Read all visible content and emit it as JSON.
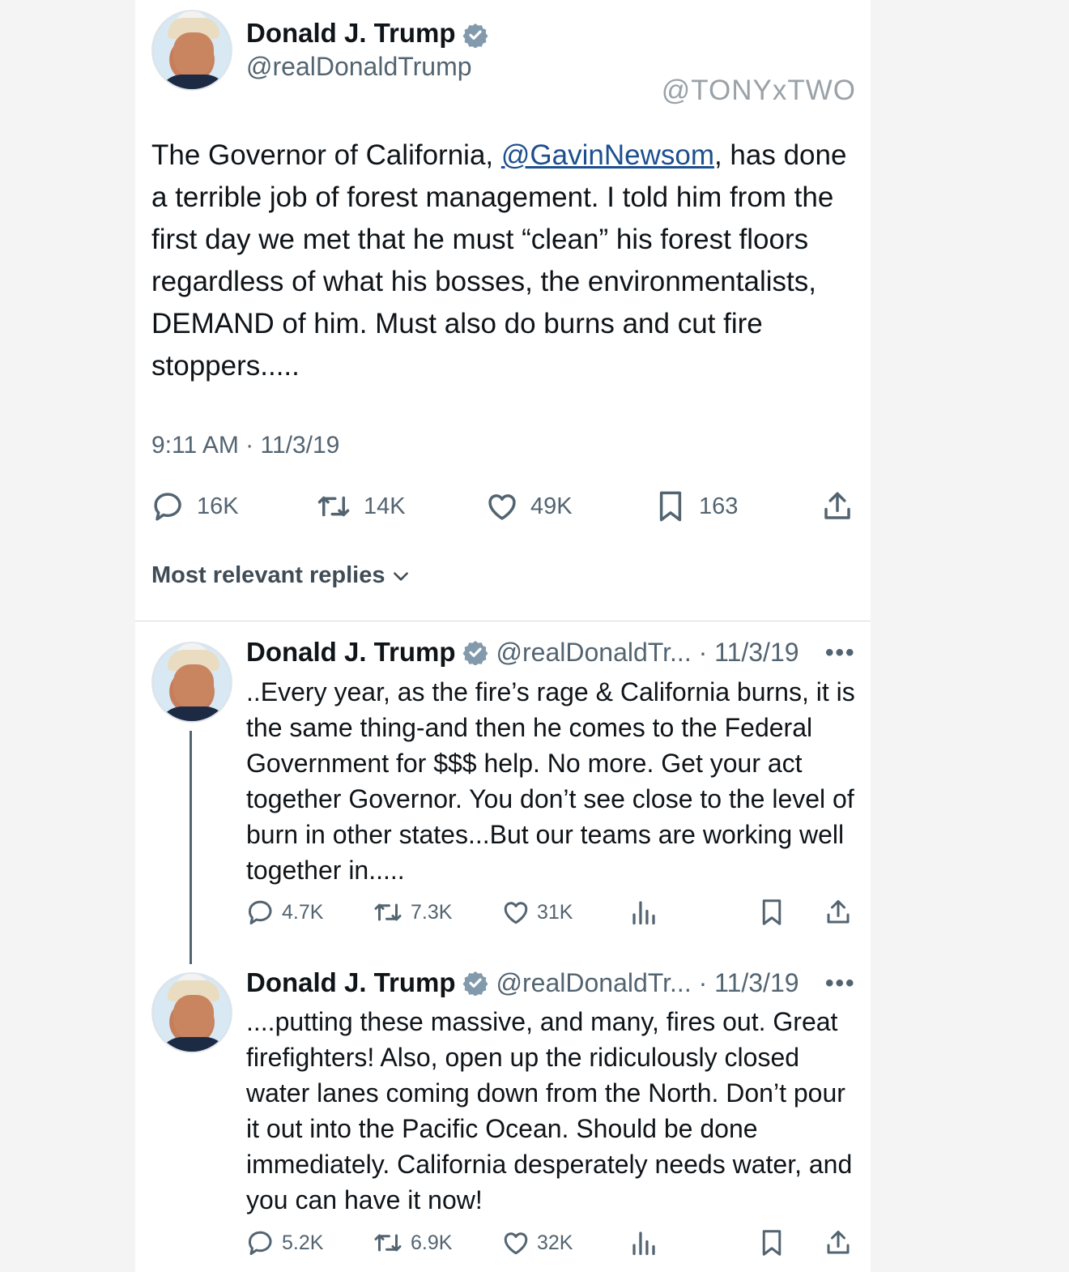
{
  "watermark": "@TONYxTWO",
  "main_tweet": {
    "name": "Donald J. Trump",
    "handle": "@realDonaldTrump",
    "text_before_mention": "The Governor of California, ",
    "mention": "@GavinNewsom",
    "text_after_mention": ", has done a terrible job of forest management. I told him from the first day we met that he must “clean” his forest floors regardless of what his bosses, the environmentalists, DEMAND of him. Must also do burns and cut fire stoppers.....",
    "timestamp": "9:11 AM · 11/3/19",
    "replies": "16K",
    "retweets": "14K",
    "likes": "49K",
    "bookmarks": "163"
  },
  "sort_label": "Most relevant replies",
  "replies": [
    {
      "name": "Donald J. Trump",
      "handle_date": "@realDonaldTr... · 11/3/19",
      "more": "•••",
      "text": "..Every year, as the fire’s rage & California burns, it is the same thing-and then he comes to the Federal Government for $$$ help. No more. Get your act together Governor. You don’t see close to the level of burn in other states...But our teams are working well together in.....",
      "replies": "4.7K",
      "retweets": "7.3K",
      "likes": "31K"
    },
    {
      "name": "Donald J. Trump",
      "handle_date": "@realDonaldTr... · 11/3/19",
      "more": "•••",
      "text": "....putting these massive, and many, fires out. Great firefighters! Also, open up the ridiculously closed water lanes coming down from the North. Don’t pour it out into the Pacific Ocean. Should be done immediately. California desperately needs water, and you can have it now!",
      "replies": "5.2K",
      "retweets": "6.9K",
      "likes": "32K"
    }
  ],
  "colors": {
    "text": "#0f1419",
    "secondary": "#536471",
    "link": "#1d4f8f",
    "verified": "#829aab"
  },
  "icons": [
    "verified-badge-icon",
    "reply-icon",
    "retweet-icon",
    "like-icon",
    "bookmark-icon",
    "share-icon",
    "views-icon",
    "chevron-down-icon",
    "more-icon"
  ]
}
